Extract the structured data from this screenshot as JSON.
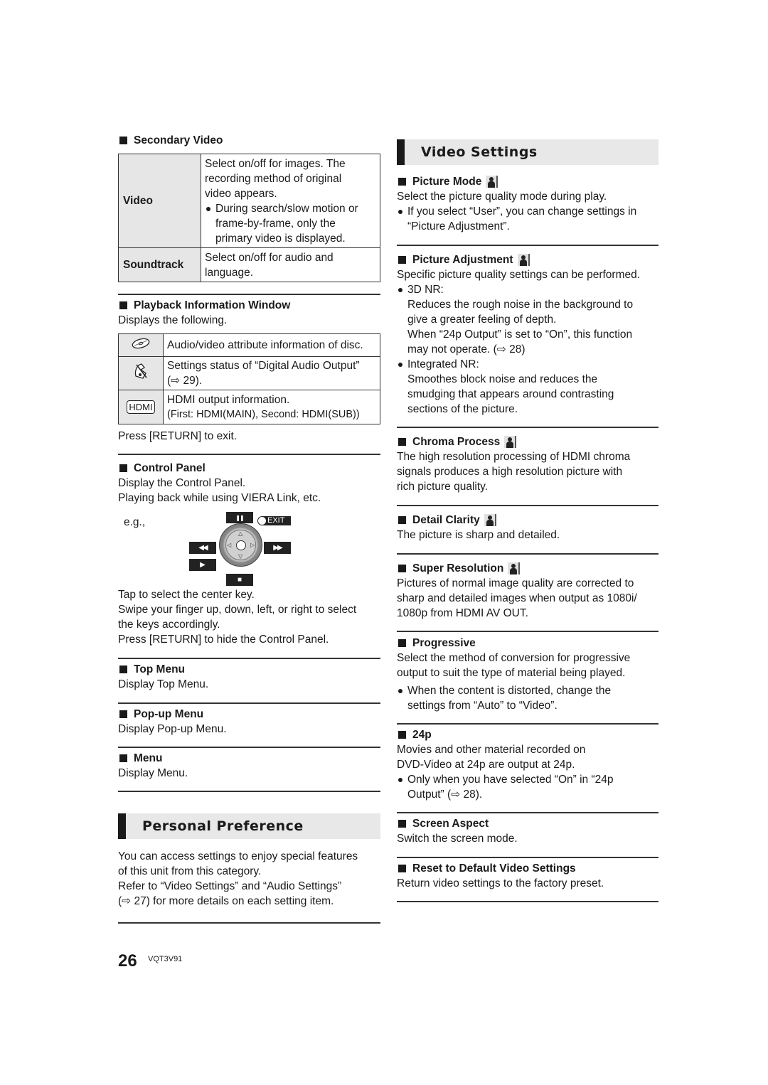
{
  "left": {
    "secondary_video": {
      "title": "Secondary Video",
      "rows": [
        {
          "label": "Video",
          "lines": [
            "Select on/off for images. The",
            "recording method of original",
            "video appears."
          ],
          "bullet": [
            "During search/slow motion or",
            "frame-by-frame, only the",
            "primary video is displayed."
          ]
        },
        {
          "label": "Soundtrack",
          "lines": [
            "Select on/off for audio and",
            "language."
          ]
        }
      ]
    },
    "playback_info": {
      "title": "Playback Information Window",
      "intro": "Displays the following.",
      "rows": [
        {
          "icon": "disc-icon",
          "lines": [
            "Audio/video attribute information of disc."
          ]
        },
        {
          "icon": "digital-audio-icon",
          "lines": [
            "Settings status of “Digital Audio Output”",
            "(⇨ 29)."
          ]
        },
        {
          "icon_text": "HDMI",
          "lines": [
            "HDMI output information.",
            "(First: HDMI(MAIN), Second: HDMI(SUB))"
          ]
        }
      ],
      "outro": "Press [RETURN] to exit."
    },
    "control_panel": {
      "title": "Control Panel",
      "lines": [
        "Display the Control Panel.",
        "Playing back while using VIERA Link, etc."
      ],
      "eg": "e.g.,",
      "keys": {
        "pause": "❚❚",
        "rewind": "◀◀",
        "fast_forward": "▶▶",
        "play": "▶",
        "stop": "■",
        "exit": "EXIT"
      },
      "after": [
        "Tap to select the center key.",
        "Swipe your finger up, down, left, or right to select",
        "the keys accordingly.",
        "Press [RETURN] to hide the Control Panel."
      ]
    },
    "top_menu": {
      "title": "Top Menu",
      "text": "Display Top Menu."
    },
    "popup_menu": {
      "title": "Pop-up Menu",
      "text": "Display Pop-up Menu."
    },
    "menu": {
      "title": "Menu",
      "text": "Display Menu."
    },
    "personal_preference": {
      "title": "Personal Preference",
      "lines": [
        "You can access settings to enjoy special features",
        "of this unit from this category.",
        "Refer to “Video Settings” and “Audio Settings”",
        "(⇨ 27) for more details on each setting item."
      ]
    }
  },
  "right": {
    "video_settings": {
      "title": "Video Settings"
    },
    "picture_mode": {
      "title": "Picture Mode",
      "text": "Select the picture quality mode during play.",
      "bullet": [
        "If you select “User”, you can change settings in",
        "“Picture Adjustment”."
      ]
    },
    "picture_adjustment": {
      "title": "Picture Adjustment",
      "text": "Specific picture quality settings can be performed.",
      "items": [
        {
          "head": "3D NR:",
          "lines": [
            "Reduces the rough noise in the background to",
            "give a greater feeling of depth.",
            "When “24p Output” is set to “On”, this function",
            "may not operate. (⇨ 28)"
          ]
        },
        {
          "head": "Integrated NR:",
          "lines": [
            "Smoothes block noise and reduces the",
            "smudging that appears around contrasting",
            "sections of the picture."
          ]
        }
      ]
    },
    "chroma_process": {
      "title": "Chroma Process",
      "lines": [
        "The high resolution processing of HDMI chroma",
        "signals produces a high resolution picture with",
        "rich picture quality."
      ]
    },
    "detail_clarity": {
      "title": "Detail Clarity",
      "text": "The picture is sharp and detailed."
    },
    "super_resolution": {
      "title": "Super Resolution",
      "lines": [
        "Pictures of normal image quality are corrected to",
        "sharp and detailed images when output as 1080i/",
        "1080p from HDMI AV OUT."
      ]
    },
    "progressive": {
      "title": "Progressive",
      "lines": [
        "Select the method of conversion for progressive",
        "output to suit the type of material being played."
      ],
      "bullet": [
        "When the content is distorted, change the",
        "settings from “Auto” to “Video”."
      ]
    },
    "p24": {
      "title": "24p",
      "lines": [
        "Movies and other material recorded on",
        "DVD-Video at 24p are output at 24p."
      ],
      "bullet": [
        "Only when you have selected “On” in “24p",
        "Output” (⇨ 28)."
      ]
    },
    "screen_aspect": {
      "title": "Screen Aspect",
      "text": "Switch the screen mode."
    },
    "reset": {
      "title": "Reset to Default Video Settings",
      "text": "Return video settings to the factory preset."
    }
  },
  "footer": {
    "page_number": "26",
    "code": "VQT3V91"
  }
}
